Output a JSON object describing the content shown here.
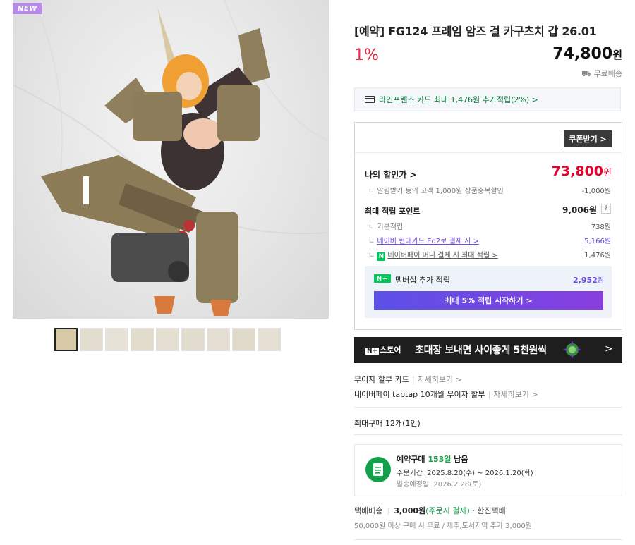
{
  "badge": "NEW",
  "product": {
    "title": "[예약] FG124 프레임 암즈 걸 카구츠치 갑 26.01",
    "discount": "1%",
    "price_value": "74,800",
    "price_unit": "원",
    "delivery": "무료배송"
  },
  "thumbnails_count": 9,
  "card_benefit": "라인프렌즈 카드 최대 1,476원 추가적립(2%) >",
  "coupon_button": "쿠폰받기 >",
  "my_price": {
    "label": "나의 할인가 >",
    "value": "73,800",
    "unit": "원",
    "sub_label": "알림받기 동의 고객 1,000원 상품중복할인",
    "sub_value": "-1,000원"
  },
  "points": {
    "label": "최대 적립 포인트",
    "value": "9,006원",
    "help": "?",
    "items": [
      {
        "label": "기본적립",
        "value": "738원"
      },
      {
        "label": "네이버 현대카드 Ed2로 결제 시 >",
        "value": "5,166원"
      },
      {
        "label": "네이버페이 머니 결제 시 최대 적립 >",
        "value": "1,476원",
        "badge": "N"
      }
    ]
  },
  "membership": {
    "icon": "N+",
    "label": "멤버십 추가 적립",
    "value": "2,952",
    "unit": "원",
    "button": "최대 5% 적립 시작하기 >"
  },
  "banner": {
    "logo_a": "N+",
    "logo_b": "스토어",
    "text": "초대장 보내면 사이좋게 5천원씩",
    "arrow": ">"
  },
  "installments": [
    {
      "text": "무이자 할부 카드",
      "more": "자세히보기 >"
    },
    {
      "text": "네이버페이 taptap 10개월 무이자 할부",
      "more": "자세히보기 >"
    }
  ],
  "max_purchase": "최대구매 12개(1인)",
  "preorder": {
    "title_a": "예약구매",
    "title_b": "153일",
    "title_c": "남음",
    "period_label": "주문기간",
    "period": "2025.8.20(수) ~ 2026.1.20(화)",
    "ship_label": "발송예정일",
    "ship_date": "2026.2.28(토)"
  },
  "shipping": {
    "type": "택배배송",
    "fee": "3,000원",
    "note": "(주문시 결제)",
    "carrier": "· 한진택배",
    "sub": "50,000원 이상 구매 시 무료 / 제주,도서지역 추가 3,000원"
  },
  "colors": {
    "discount_red": "#e32e4a",
    "price_red": "#e3002c",
    "naver_green": "#03c75a",
    "member_purple": "#6b4ae0"
  }
}
